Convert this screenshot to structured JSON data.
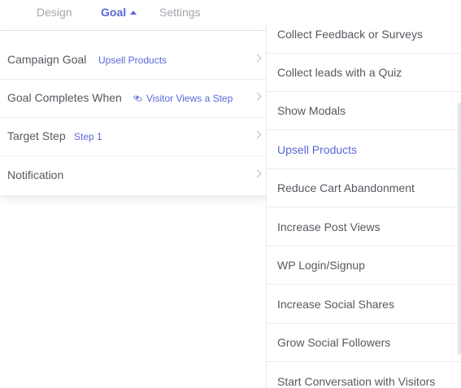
{
  "tabs": {
    "design": "Design",
    "goal": "Goal",
    "settings": "Settings"
  },
  "panel": {
    "campaign_goal": {
      "label": "Campaign Goal",
      "value": "Upsell Products"
    },
    "goal_completes": {
      "label": "Goal Completes When",
      "value": "Visitor Views a Step"
    },
    "target_step": {
      "label": "Target Step",
      "value": "Step 1"
    },
    "notification": {
      "label": "Notification"
    }
  },
  "dropdown": {
    "selected": "Upsell Products",
    "options": [
      "Collect Feedback or Surveys",
      "Collect leads with a Quiz",
      "Show Modals",
      "Upsell Products",
      "Reduce Cart Abandonment",
      "Increase Post Views",
      "WP Login/Signup",
      "Increase Social Shares",
      "Grow Social Followers",
      "Start Conversation with Visitors"
    ]
  },
  "icons": {
    "eye": "eye-icon",
    "chevron": "chevron-right-icon",
    "caret": "caret-up-icon"
  },
  "colors": {
    "accent": "#5a67d8",
    "text": "#55595f",
    "muted": "#a3a7ad",
    "divider": "#ececef"
  }
}
